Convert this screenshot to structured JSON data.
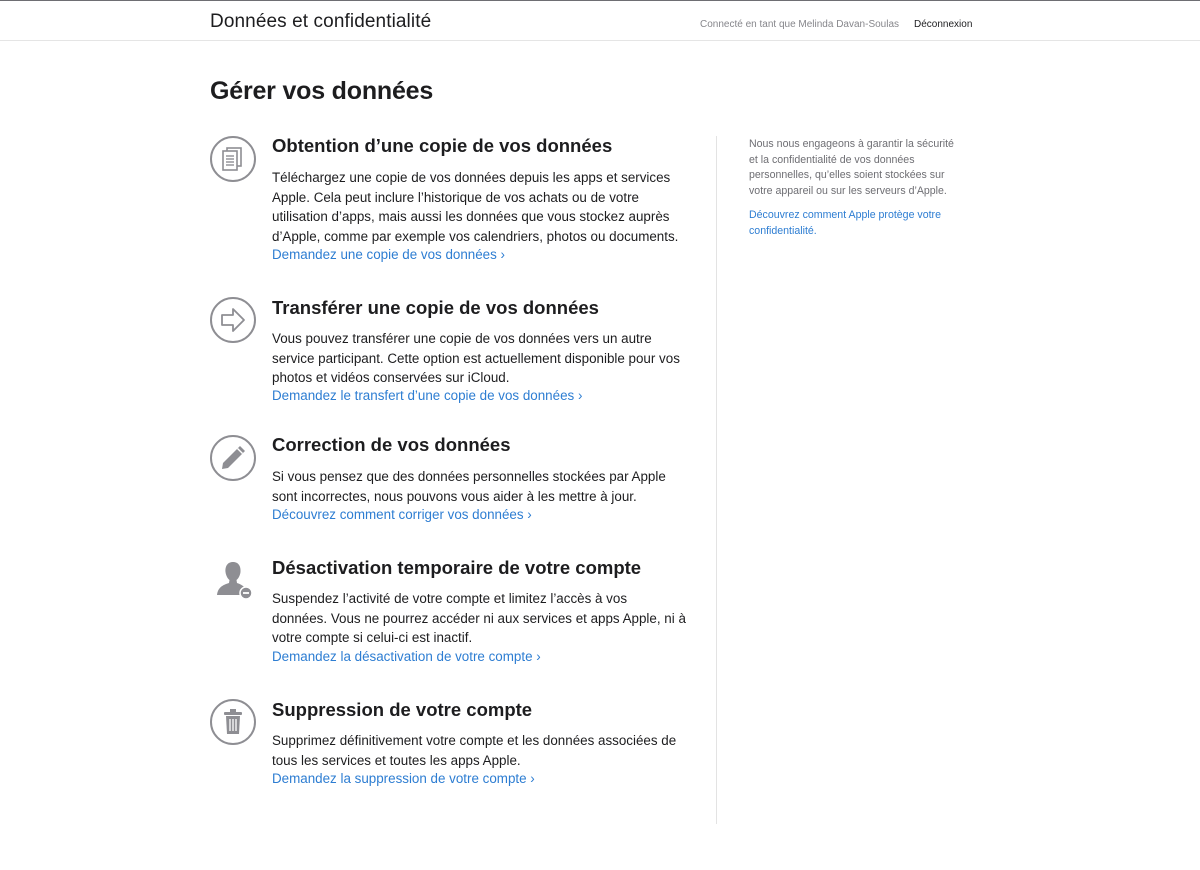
{
  "header": {
    "title": "Données et confidentialité",
    "signed_in": "Connecté en tant que Melinda Davan-Soulas",
    "logout": "Déconnexion"
  },
  "main": {
    "title": "Gérer vos données",
    "sections": [
      {
        "icon": "document-copy-icon",
        "title": "Obtention d’une copie de vos données",
        "lines": [
          "Téléchargez une copie de vos données depuis les apps et services",
          "Apple. Cela peut inclure l’historique de vos achats ou de votre",
          "utilisation d’apps, mais aussi les données que vous stockez auprès",
          "d’Apple, comme par exemple vos calendriers, photos ou documents."
        ],
        "link": "Demandez une copie de vos données ›"
      },
      {
        "icon": "arrow-right-icon",
        "title": "Transférer une copie de vos données",
        "lines": [
          "Vous pouvez transférer une copie de vos données vers un autre",
          "service participant. Cette option est actuellement disponible pour vos",
          "photos et vidéos conservées sur iCloud."
        ],
        "link": "Demandez le transfert d’une copie de vos données ›"
      },
      {
        "icon": "pencil-icon",
        "title": "Correction de vos données",
        "lines": [
          "Si vous pensez que des données personnelles stockées par Apple",
          "sont incorrectes, nous pouvons vous aider à les mettre à jour."
        ],
        "link": "Découvrez comment corriger vos données ›"
      },
      {
        "icon": "person-minus-icon",
        "title": "Désactivation temporaire de votre compte",
        "lines": [
          "Suspendez l’activité de votre compte et limitez l’accès à vos",
          "données. Vous ne pourrez accéder ni aux services et apps Apple, ni à",
          "votre compte si celui-ci est inactif."
        ],
        "link": "Demandez la désactivation de votre compte ›"
      },
      {
        "icon": "trash-icon",
        "title": "Suppression de votre compte",
        "lines": [
          "Supprimez définitivement votre compte et les données associées de",
          "tous les services et toutes les apps Apple."
        ],
        "link": "Demandez la suppression de votre compte ›"
      }
    ]
  },
  "sidebar": {
    "text_lines": [
      "Nous nous engageons à garantir la sécurité",
      "et la confidentialité de vos données",
      "personnelles, qu’elles soient stockées sur",
      "votre appareil ou sur les serveurs d’Apple."
    ],
    "link_lines": [
      "Découvrez comment Apple protège votre",
      "confidentialité."
    ]
  },
  "colors": {
    "link": "#2d7dd2",
    "text": "#1d1d1f",
    "muted": "#6e6e73",
    "icon": "#8e8e93"
  }
}
